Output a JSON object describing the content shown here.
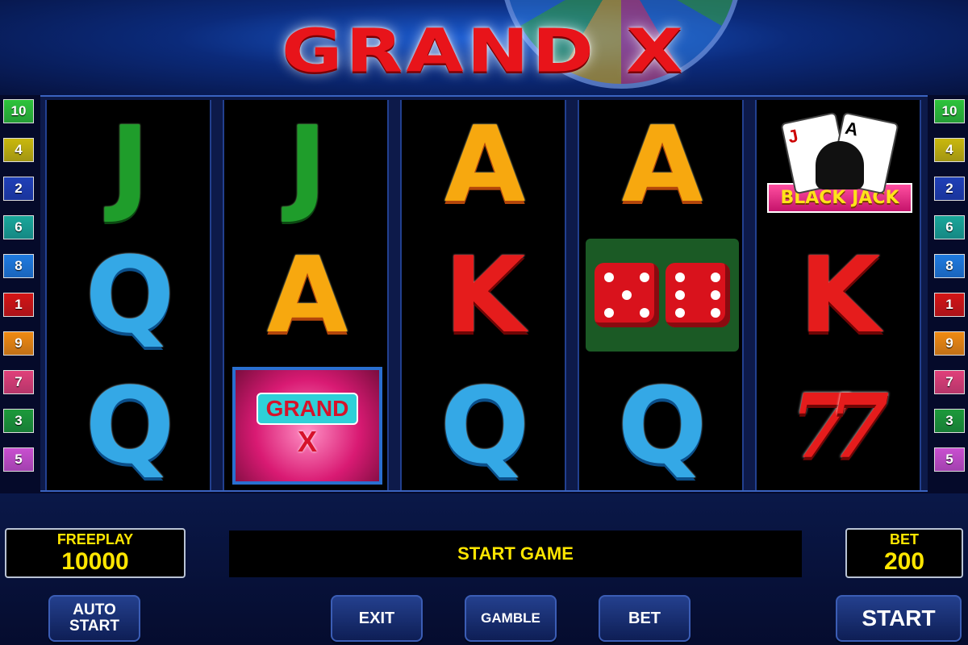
{
  "header": {
    "logo_text": "GRAND X"
  },
  "lines": {
    "left": [
      {
        "number": "10",
        "color": "#2dc33a"
      },
      {
        "number": "4",
        "color": "#c9b80d"
      },
      {
        "number": "2",
        "color": "#1f3fb8"
      },
      {
        "number": "6",
        "color": "#19a79a"
      },
      {
        "number": "8",
        "color": "#1f7be0"
      },
      {
        "number": "1",
        "color": "#d41515"
      },
      {
        "number": "9",
        "color": "#f08a12"
      },
      {
        "number": "7",
        "color": "#e0407a"
      },
      {
        "number": "3",
        "color": "#1c9a3a"
      },
      {
        "number": "5",
        "color": "#c94fd0"
      }
    ],
    "right": [
      {
        "number": "10",
        "color": "#2dc33a"
      },
      {
        "number": "4",
        "color": "#c9b80d"
      },
      {
        "number": "2",
        "color": "#1f3fb8"
      },
      {
        "number": "6",
        "color": "#19a79a"
      },
      {
        "number": "8",
        "color": "#1f7be0"
      },
      {
        "number": "1",
        "color": "#d41515"
      },
      {
        "number": "9",
        "color": "#f08a12"
      },
      {
        "number": "7",
        "color": "#e0407a"
      },
      {
        "number": "3",
        "color": "#1c9a3a"
      },
      {
        "number": "5",
        "color": "#c94fd0"
      }
    ]
  },
  "reels": [
    [
      "J",
      "Q",
      "Q"
    ],
    [
      "J",
      "A",
      "GRAND X"
    ],
    [
      "A",
      "K",
      "Q"
    ],
    [
      "A",
      "dice",
      "Q"
    ],
    [
      "BLACK JACK",
      "K",
      "7"
    ]
  ],
  "symbols": {
    "grandx_top": "GRAND",
    "grandx_bottom": "X",
    "blackjack_label": "BLACK JACK",
    "seven": "7"
  },
  "freeplay": {
    "label": "FREEPLAY",
    "value": "10000"
  },
  "bet": {
    "label": "BET",
    "value": "200"
  },
  "message": "START GAME",
  "buttons": {
    "auto_start_1": "AUTO",
    "auto_start_2": "START",
    "exit": "EXIT",
    "gamble": "GAMBLE",
    "bet": "BET",
    "start": "START"
  }
}
